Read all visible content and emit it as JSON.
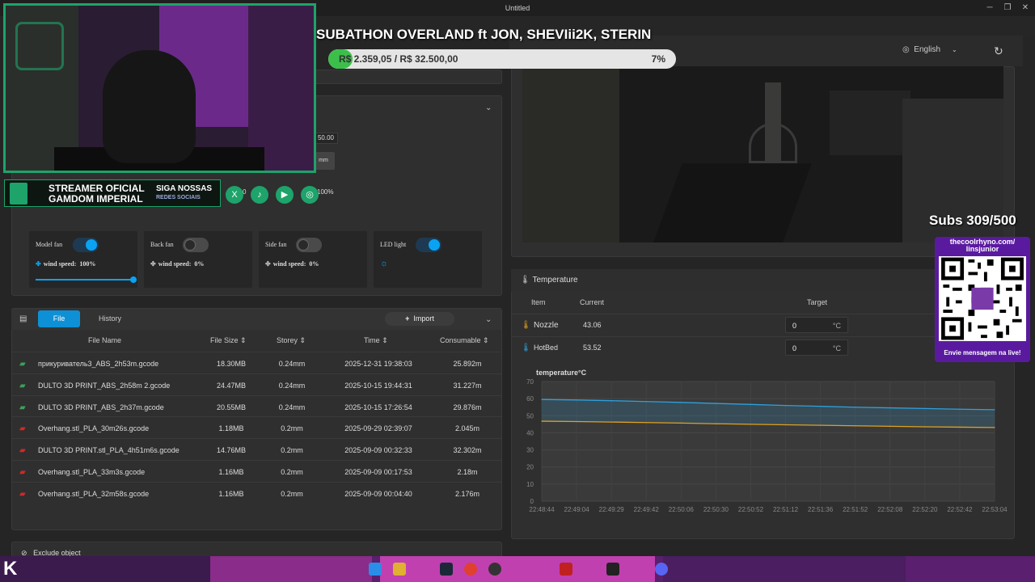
{
  "window": {
    "title": "Untitled"
  },
  "header": {
    "language": "English"
  },
  "fans": [
    {
      "name": "Model fan",
      "wind_label": "wind speed:",
      "wind_value": "100%",
      "on": true
    },
    {
      "name": "Back fan",
      "wind_label": "wind speed:",
      "wind_value": "0%",
      "on": false
    },
    {
      "name": "Side fan",
      "wind_label": "wind speed:",
      "wind_value": "0%",
      "on": false
    },
    {
      "name": "LED light",
      "on": true
    }
  ],
  "partial": {
    "v1": "50.00",
    "v2": "0",
    "v3": "100%",
    "v4": "mm"
  },
  "files": {
    "tab_file": "File",
    "tab_history": "History",
    "import_label": "Import",
    "columns": [
      "File Name",
      "File Size",
      "Storey",
      "Time",
      "Consumable"
    ],
    "rows": [
      {
        "name": "прикуриватель3_ABS_2h53m.gcode",
        "size": "18.30MB",
        "storey": "0.24mm",
        "time": "2025-12-31 19:38:03",
        "consumable": "25.892m"
      },
      {
        "name": "DULTO 3D PRINT_ABS_2h58m 2.gcode",
        "size": "24.47MB",
        "storey": "0.24mm",
        "time": "2025-10-15 19:44:31",
        "consumable": "31.227m"
      },
      {
        "name": "DULTO 3D PRINT_ABS_2h37m.gcode",
        "size": "20.55MB",
        "storey": "0.24mm",
        "time": "2025-10-15 17:26:54",
        "consumable": "29.876m"
      },
      {
        "name": "Overhang.stl_PLA_30m26s.gcode",
        "size": "1.18MB",
        "storey": "0.2mm",
        "time": "2025-09-29 02:39:07",
        "consumable": "2.045m"
      },
      {
        "name": "DULTO 3D PRINT.stl_PLA_4h51m6s.gcode",
        "size": "14.76MB",
        "storey": "0.2mm",
        "time": "2025-09-09 00:32:33",
        "consumable": "32.302m"
      },
      {
        "name": "Overhang.stl_PLA_33m3s.gcode",
        "size": "1.16MB",
        "storey": "0.2mm",
        "time": "2025-09-09 00:17:53",
        "consumable": "2.18m"
      },
      {
        "name": "Overhang.stl_PLA_32m58s.gcode",
        "size": "1.16MB",
        "storey": "0.2mm",
        "time": "2025-09-09 00:04:40",
        "consumable": "2.176m"
      }
    ]
  },
  "exclude": {
    "label": "Exclude object"
  },
  "temperature": {
    "title": "Temperature",
    "columns": [
      "Item",
      "Current",
      "Target"
    ],
    "rows": [
      {
        "item": "Nozzle",
        "current": "43.06",
        "target": "0",
        "unit": "°C"
      },
      {
        "item": "HotBed",
        "current": "53.52",
        "target": "0",
        "unit": "°C"
      }
    ]
  },
  "chart_data": {
    "type": "line",
    "title": "temperature°C",
    "x": [
      "22:48:44",
      "22:49:04",
      "22:49:29",
      "22:49:42",
      "22:50:06",
      "22:50:30",
      "22:50:52",
      "22:51:12",
      "22:51:36",
      "22:51:52",
      "22:52:08",
      "22:52:20",
      "22:52:42",
      "22:53:04"
    ],
    "ylim": [
      0,
      70
    ],
    "yticks": [
      0,
      10,
      20,
      30,
      40,
      50,
      60,
      70
    ],
    "grid": true,
    "series": [
      {
        "values": [
          59.5,
          59.2,
          58.8,
          58.3,
          57.8,
          57.2,
          56.6,
          56.0,
          55.5,
          55.0,
          54.6,
          54.2,
          53.8,
          53.5
        ],
        "color": "#2ea0dc"
      },
      {
        "values": [
          46.8,
          46.6,
          46.3,
          46.0,
          45.7,
          45.3,
          45.0,
          44.7,
          44.4,
          44.1,
          43.8,
          43.5,
          43.3,
          43.1
        ],
        "color": "#e0a020"
      }
    ]
  },
  "overlay": {
    "title": "SUBATHON OVERLAND ft JON, SHEVIii2K, STERIN",
    "goal_text": "R$ 2.359,05 / R$ 32.500,00",
    "goal_percent": "7%",
    "goal_fraction": 0.07,
    "subs": "Subs 309/500",
    "qr_handle_1": "thecoolrhyno.com/",
    "qr_handle_2": "linsjunior",
    "qr_cta": "Envie mensagem na live!",
    "banner_l1": "STREAMER OFICIAL",
    "banner_l2": "GAMDOM IMPERIAL",
    "banner_r1": "SIGA NOSSAS",
    "banner_r2": "REDES SOCIAIS",
    "socials": [
      "X",
      "♪",
      "▶",
      "◎"
    ]
  },
  "colors": {
    "accent": "#0aa2f2",
    "brand_green": "#1ea36a"
  }
}
